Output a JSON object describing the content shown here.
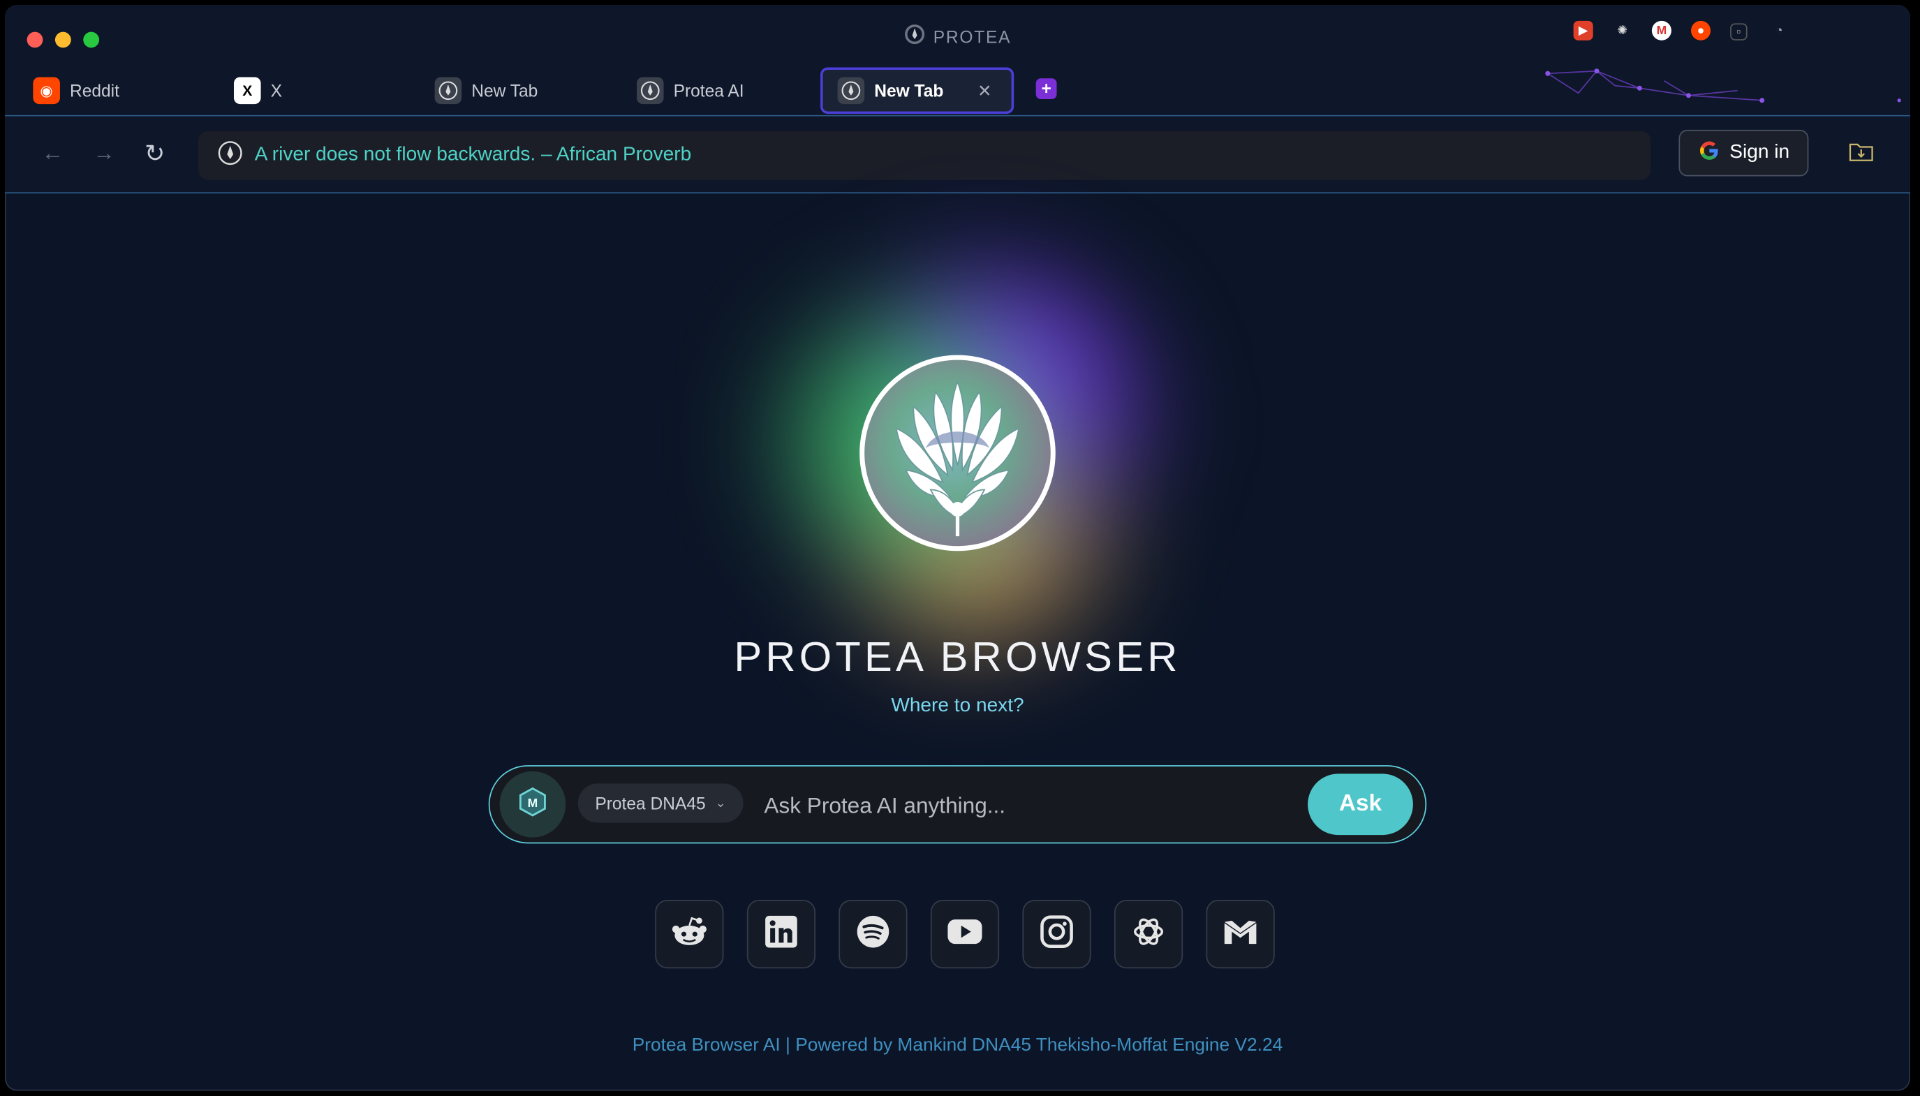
{
  "window": {
    "title": "PROTEA"
  },
  "extensions": [
    "youtube-icon",
    "openai-icon",
    "gmail-icon",
    "reddit-icon",
    "square-icon",
    "palette-icon"
  ],
  "tabs": [
    {
      "label": "Reddit",
      "icon": "reddit-icon"
    },
    {
      "label": "X",
      "icon": "x-icon"
    },
    {
      "label": "New Tab",
      "icon": "protea-icon"
    },
    {
      "label": "Protea AI",
      "icon": "protea-icon"
    },
    {
      "label": "New Tab",
      "icon": "protea-icon",
      "active": true
    }
  ],
  "address_bar": {
    "text": "A river does not flow backwards. – African Proverb"
  },
  "signin": {
    "label": "Sign in"
  },
  "hero": {
    "title": "PROTEA BROWSER",
    "subtitle": "Where to next?"
  },
  "ask": {
    "model": "Protea DNA45",
    "placeholder": "Ask Protea AI anything...",
    "button": "Ask"
  },
  "shortcuts": [
    "reddit-icon",
    "linkedin-icon",
    "spotify-icon",
    "youtube-icon",
    "instagram-icon",
    "openai-icon",
    "gmail-icon"
  ],
  "footer": {
    "text": "Protea Browser AI | Powered by Mankind DNA45 Thekisho-Moffat Engine V2.24"
  },
  "colors": {
    "background": "#0c1527",
    "accent": "#4fc6c9",
    "active_tab_border": "#4b3fd8"
  }
}
